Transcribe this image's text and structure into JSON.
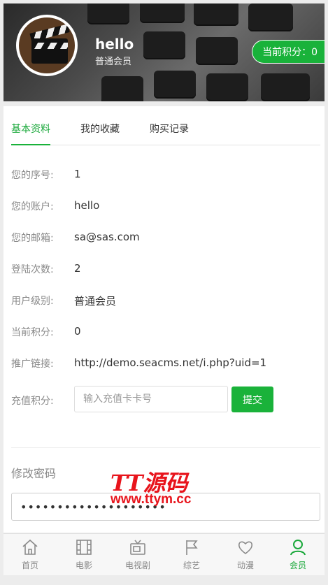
{
  "header": {
    "username": "hello",
    "level": "普通会员",
    "points_badge": "当前积分：0"
  },
  "tabs": [
    "基本资料",
    "我的收藏",
    "购买记录"
  ],
  "profile": {
    "rows": [
      {
        "label": "您的序号:",
        "value": "1"
      },
      {
        "label": "您的账户:",
        "value": "hello"
      },
      {
        "label": "您的邮箱:",
        "value": "sa@sas.com"
      },
      {
        "label": "登陆次数:",
        "value": "2"
      },
      {
        "label": "用户级别:",
        "value": "普通会员"
      },
      {
        "label": "当前积分:",
        "value": "0"
      },
      {
        "label": "推广链接:",
        "value": "http://demo.seacms.net/i.php?uid=1"
      }
    ],
    "recharge_label": "充值积分:",
    "recharge_placeholder": "输入充值卡卡号",
    "submit_label": "提交"
  },
  "password": {
    "title": "修改密码",
    "value": "••••••••••••••••••••"
  },
  "watermark": {
    "brand": "TT源码",
    "url": "www.ttym.cc"
  },
  "bottom_nav": {
    "items": [
      {
        "label": "首页",
        "icon": "home-icon"
      },
      {
        "label": "电影",
        "icon": "film-icon"
      },
      {
        "label": "电视剧",
        "icon": "tv-icon"
      },
      {
        "label": "综艺",
        "icon": "flag-icon"
      },
      {
        "label": "动漫",
        "icon": "heart-icon"
      },
      {
        "label": "会员",
        "icon": "user-icon"
      }
    ],
    "active": "会员"
  },
  "colors": {
    "accent": "#19b23a",
    "watermark": "#e8141c"
  }
}
